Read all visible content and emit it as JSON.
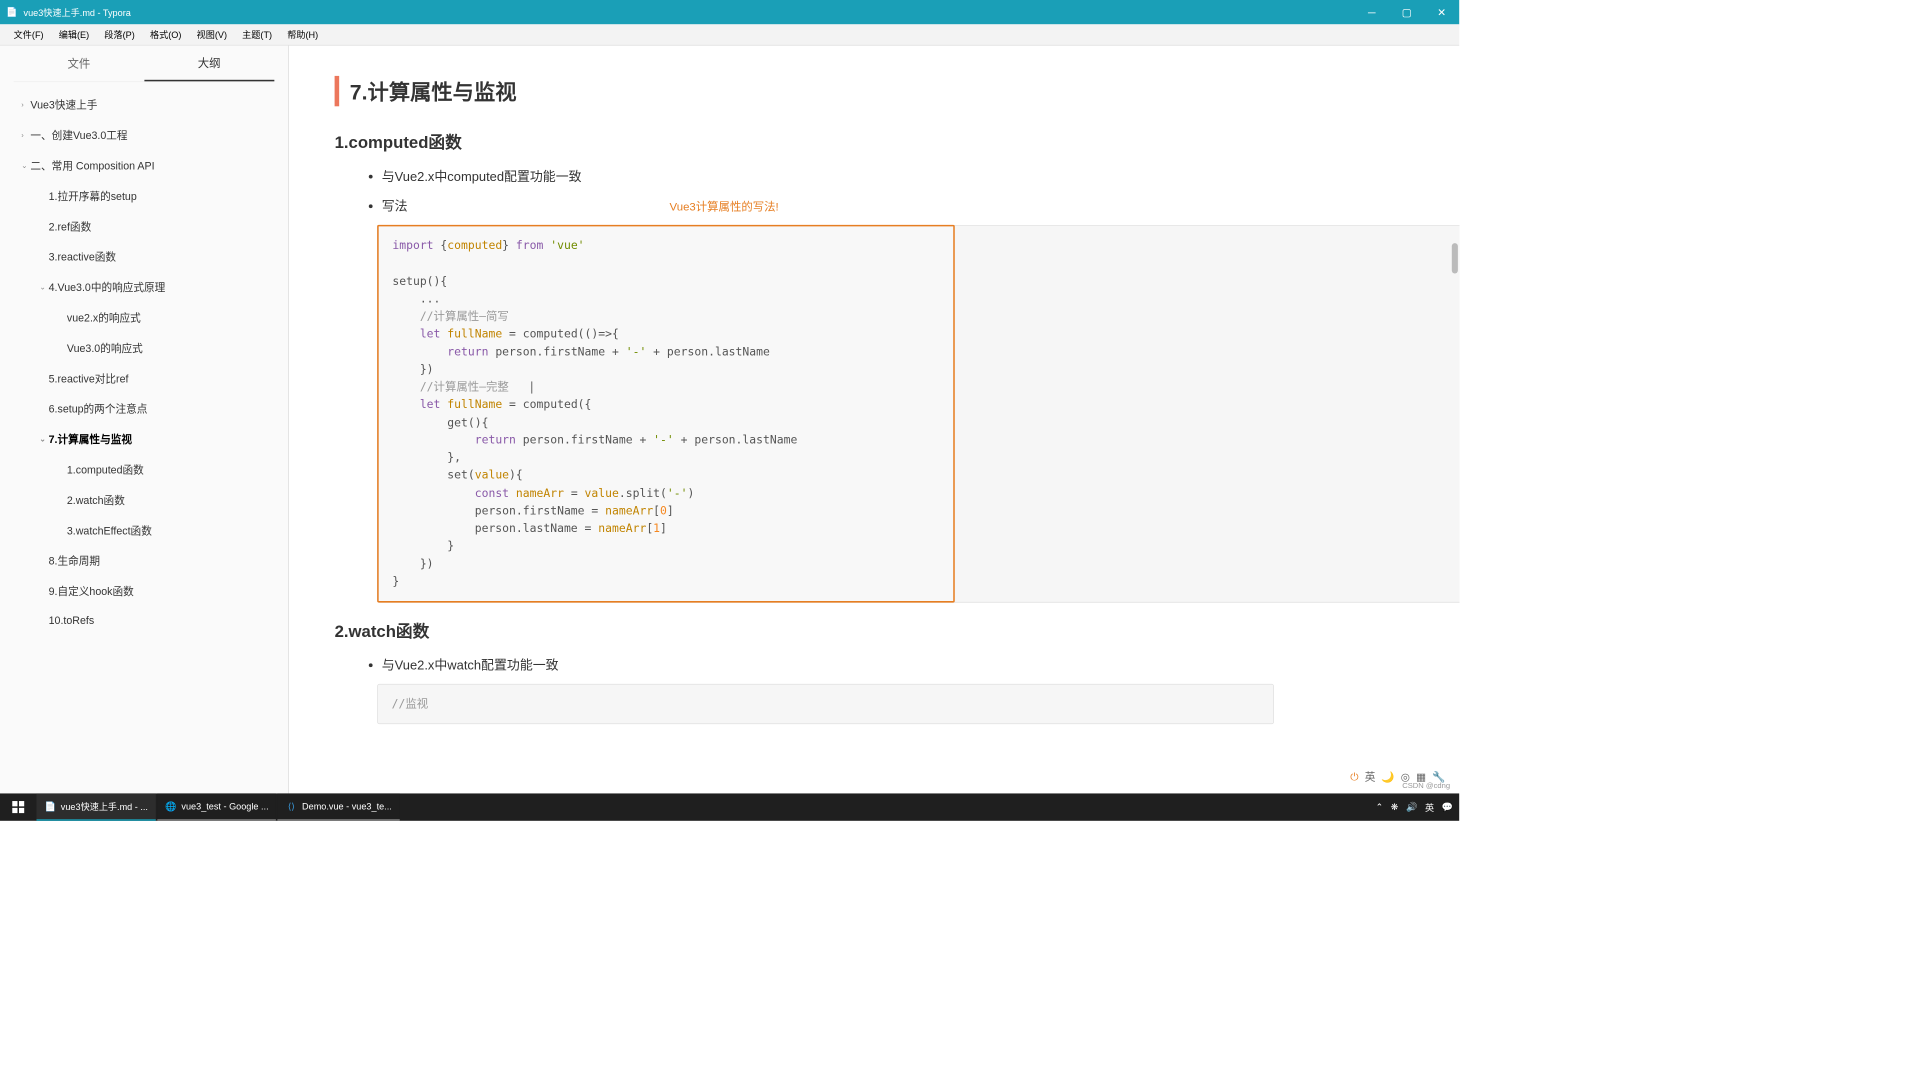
{
  "window": {
    "title": "vue3快速上手.md - Typora"
  },
  "menubar": [
    "文件(F)",
    "编辑(E)",
    "段落(P)",
    "格式(O)",
    "视图(V)",
    "主题(T)",
    "帮助(H)"
  ],
  "sidebar": {
    "tabs": {
      "files": "文件",
      "outline": "大纲"
    },
    "outline": [
      {
        "label": "Vue3快速上手",
        "level": 1,
        "arrow": "›"
      },
      {
        "label": "一、创建Vue3.0工程",
        "level": 1,
        "arrow": "›"
      },
      {
        "label": "二、常用 Composition API",
        "level": 1,
        "arrow": "⌄"
      },
      {
        "label": "1.拉开序幕的setup",
        "level": 2,
        "arrow": ""
      },
      {
        "label": "2.ref函数",
        "level": 2,
        "arrow": ""
      },
      {
        "label": "3.reactive函数",
        "level": 2,
        "arrow": ""
      },
      {
        "label": "4.Vue3.0中的响应式原理",
        "level": 2,
        "arrow": "⌄"
      },
      {
        "label": "vue2.x的响应式",
        "level": 3,
        "arrow": ""
      },
      {
        "label": "Vue3.0的响应式",
        "level": 3,
        "arrow": ""
      },
      {
        "label": "5.reactive对比ref",
        "level": 2,
        "arrow": ""
      },
      {
        "label": "6.setup的两个注意点",
        "level": 2,
        "arrow": ""
      },
      {
        "label": "7.计算属性与监视",
        "level": 2,
        "arrow": "⌄",
        "active": true
      },
      {
        "label": "1.computed函数",
        "level": 3,
        "arrow": ""
      },
      {
        "label": "2.watch函数",
        "level": 3,
        "arrow": ""
      },
      {
        "label": "3.watchEffect函数",
        "level": 3,
        "arrow": ""
      },
      {
        "label": "8.生命周期",
        "level": 2,
        "arrow": ""
      },
      {
        "label": "9.自定义hook函数",
        "level": 2,
        "arrow": ""
      },
      {
        "label": "10.toRefs",
        "level": 2,
        "arrow": ""
      }
    ]
  },
  "content": {
    "h2": "7.计算属性与监视",
    "h3a": "1.computed函数",
    "bullet1": "与Vue2.x中computed配置功能一致",
    "bullet2": "写法",
    "annotation": "Vue3计算属性的写法!",
    "lang": "js",
    "h3b": "2.watch函数",
    "bullet3": "与Vue2.x中watch配置功能一致",
    "code2_line": "//监视"
  },
  "taskbar": {
    "tasks": [
      "vue3快速上手.md - ...",
      "vue3_test - Google ...",
      "Demo.vue - vue3_te..."
    ],
    "tray": {
      "ime": "英"
    }
  },
  "tooltray": {
    "ime": "英"
  },
  "watermark": "CSDN @cdng"
}
